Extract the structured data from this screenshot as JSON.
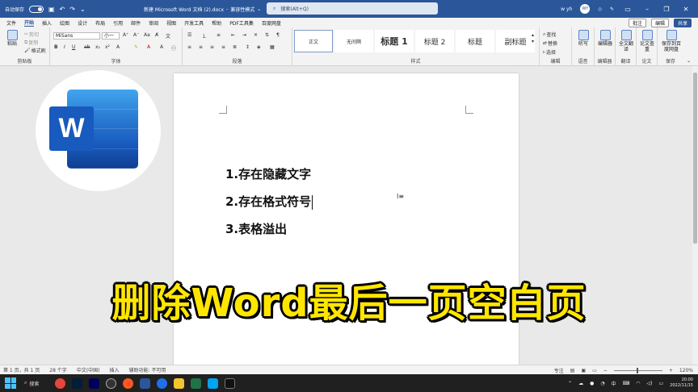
{
  "titlebar": {
    "autosave_label": "自动保存",
    "autosave_state": "关",
    "doc_title": "新建 Microsoft Word 文档 (2).docx",
    "mode": "兼容性模式",
    "search_placeholder": "搜索(Alt+Q)",
    "user": "w yh",
    "avatar": "WY"
  },
  "tabs": [
    "文件",
    "开始",
    "插入",
    "绘图",
    "设计",
    "布局",
    "引用",
    "邮件",
    "审阅",
    "视图",
    "开发工具",
    "帮助",
    "PDF工具集",
    "百度网盘"
  ],
  "tabs_right": {
    "comments": "批注",
    "edit": "编辑",
    "share": "共享"
  },
  "ribbon": {
    "clipboard": {
      "paste": "粘贴",
      "cut": "剪切",
      "copy": "复制",
      "format_painter": "格式刷",
      "label": "剪贴板"
    },
    "font": {
      "name": "MiSans",
      "size": "小一",
      "label": "字体"
    },
    "paragraph": {
      "label": "段落"
    },
    "styles": {
      "items": [
        "正文",
        "无间隔",
        "标题 1",
        "标题 2",
        "标题",
        "副标题"
      ],
      "label": "样式"
    },
    "editing": {
      "find": "查找",
      "replace": "替换",
      "select": "选择",
      "label": "编辑"
    },
    "dictate": {
      "label": "听写",
      "group": "语音"
    },
    "editor": {
      "label": "编辑器",
      "group": "编辑器"
    },
    "translate": {
      "label": "全文翻译",
      "group": "翻译"
    },
    "paper": {
      "label": "论文查重",
      "group": "论文"
    },
    "save": {
      "label": "保存到百度网盘",
      "group": "保存"
    }
  },
  "document": {
    "lines": [
      "1.存在隐藏文字",
      "2.存在格式符号",
      "3.表格溢出"
    ]
  },
  "logo_letter": "W",
  "headline": "删除Word最后一页空白页",
  "statusbar": {
    "page": "第 1 页，共 1 页",
    "words": "28 个字",
    "lang": "中文(中国)",
    "insert": "插入",
    "accessibility": "辅助功能: 不可用",
    "focus": "专注",
    "zoom": "120%"
  },
  "taskbar": {
    "search": "搜索",
    "ime": "中",
    "time": "20:00",
    "date": "2022/11/15"
  },
  "colors": {
    "word_blue": "#2b579a",
    "headline_yellow": "#ffe600"
  }
}
